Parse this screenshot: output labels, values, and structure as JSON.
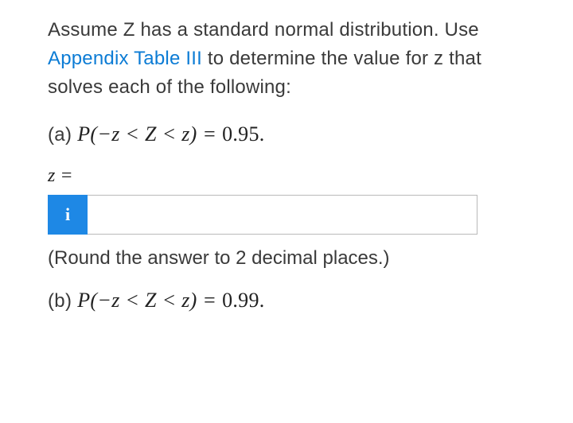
{
  "intro": {
    "text_before_link": "Assume Z has a standard normal distribution. Use ",
    "link_text": "Appendix Table III",
    "text_after_link": " to determine the value for z that solves each of the following:"
  },
  "parts": {
    "a": {
      "label": "(a) ",
      "expr_lhs": "P(−z < Z < z) = ",
      "expr_rhs": "0.95.",
      "prompt": "z =",
      "info_icon": "i",
      "hint": "(Round the answer to 2 decimal places.)"
    },
    "b": {
      "label": "(b) ",
      "expr_lhs": "P(−z < Z < z) = ",
      "expr_rhs": "0.99."
    }
  },
  "input": {
    "value": "",
    "placeholder": ""
  }
}
